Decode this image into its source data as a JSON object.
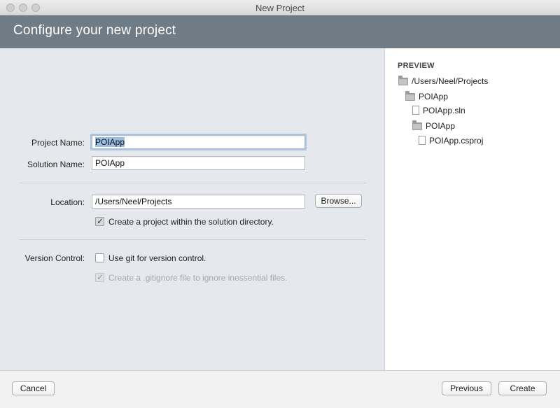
{
  "window": {
    "title": "New Project"
  },
  "header": {
    "title": "Configure your new project"
  },
  "form": {
    "project_name": {
      "label": "Project Name:",
      "value": "POIApp"
    },
    "solution_name": {
      "label": "Solution Name:",
      "value": "POIApp"
    },
    "location": {
      "label": "Location:",
      "value": "/Users/Neel/Projects",
      "browse_label": "Browse..."
    },
    "create_in_solution_dir": {
      "label": "Create a project within the solution directory.",
      "checked": true
    },
    "version_control": {
      "label": "Version Control:",
      "use_git": {
        "label": "Use git for version control.",
        "checked": false
      },
      "gitignore": {
        "label": "Create a .gitignore file to ignore inessential files.",
        "checked": true,
        "disabled": true
      }
    }
  },
  "preview": {
    "heading": "PREVIEW",
    "tree": [
      {
        "name": "/Users/Neel/Projects",
        "type": "folder",
        "depth": 0
      },
      {
        "name": "POIApp",
        "type": "folder",
        "depth": 1
      },
      {
        "name": "POIApp.sln",
        "type": "file",
        "depth": 2
      },
      {
        "name": "POIApp",
        "type": "folder",
        "depth": 2
      },
      {
        "name": "POIApp.csproj",
        "type": "file",
        "depth": 3
      }
    ]
  },
  "footer": {
    "cancel_label": "Cancel",
    "previous_label": "Previous",
    "create_label": "Create"
  },
  "colors": {
    "banner": "#6f7b85",
    "form_bg": "#e5e8ec",
    "selection": "#9bbce3"
  },
  "icons": {
    "folder": "folder-icon",
    "file": "file-icon"
  }
}
